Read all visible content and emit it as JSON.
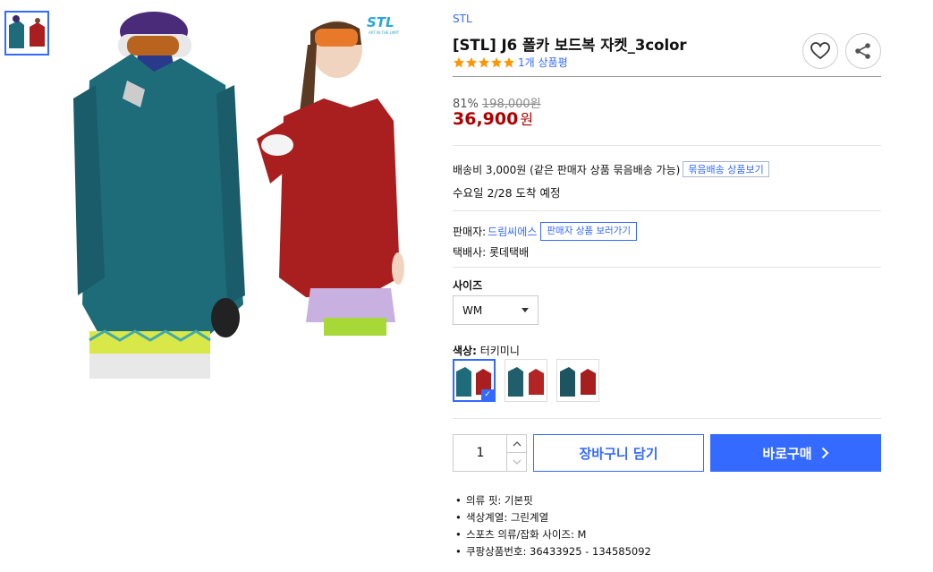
{
  "colors": {
    "accent": "#346aff",
    "sale": "#ae0000",
    "teal": "#1e6b7a",
    "red": "#a91f1f"
  },
  "product": {
    "brand": "STL",
    "title": "[STL] J6 폴카 보드복 자켓_3color",
    "rating": 5,
    "review_count": "1개 상품평",
    "discount_rate": "81%",
    "original_price": "198,000원",
    "sale_price": "36,900",
    "currency": "원"
  },
  "image": {
    "logo_text": "STL",
    "logo_tagline": "ART IN THE LIMIT"
  },
  "shipping": {
    "fee_text": "배송비 3,000원 (같은 판매자 상품 묶음배송 가능)",
    "bundle_button": "묶음배송 상품보기",
    "arrival": "수요일 2/28 도착 예정"
  },
  "seller": {
    "label": "판매자:",
    "name": "드림씨에스",
    "more_button": "판매자 상품 보러가기",
    "courier": "택배사: 롯데택배"
  },
  "options": {
    "size_label": "사이즈",
    "size_value": "WM",
    "color_label": "색상:",
    "color_value": "터키미니"
  },
  "purchase": {
    "quantity": "1",
    "cart_button": "장바구니 담기",
    "buy_button": "바로구매"
  },
  "attributes": [
    "의류 핏: 기본핏",
    "색상계열: 그린계열",
    "스포츠 의류/잡화 사이즈: M",
    "쿠팡상품번호: 36433925 - 134585092"
  ],
  "icons": {
    "favorite": "heart-icon",
    "share": "share-icon",
    "star": "star-icon",
    "check": "check-icon",
    "caret": "caret-down-icon",
    "chevron": "chevron-right-icon"
  }
}
